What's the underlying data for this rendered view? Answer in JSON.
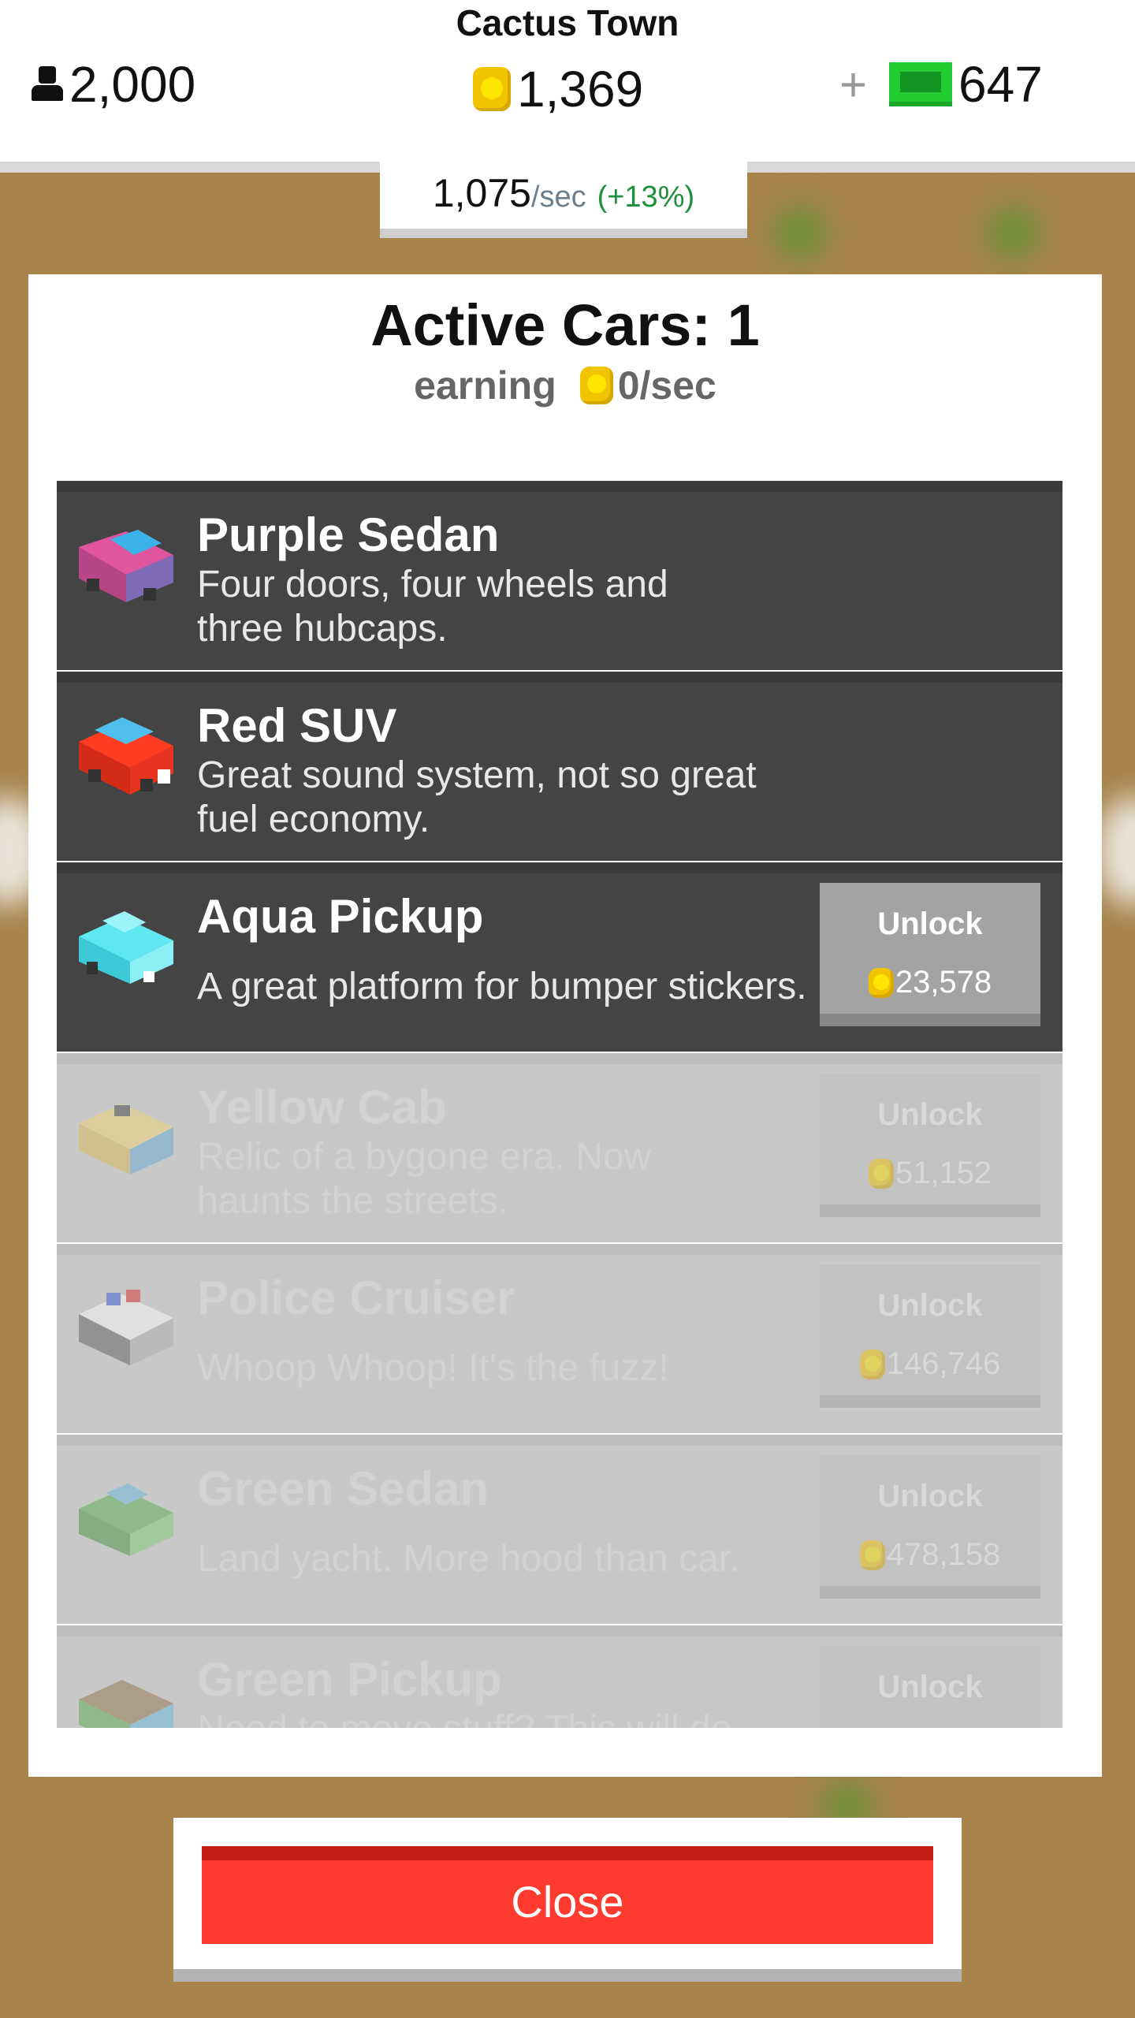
{
  "header": {
    "town_name": "Cactus Town",
    "population": "2,000",
    "coins": "1,369",
    "cash_plus": "+",
    "cash": "647",
    "rate_value": "1,075",
    "rate_unit": "/sec",
    "rate_pct": "(+13%)"
  },
  "modal": {
    "title": "Active Cars: 1",
    "earning_label": "earning",
    "earning_value": "0/sec",
    "cars": [
      {
        "name": "Purple Sedan",
        "desc": "Four doors, four wheels and three hubcaps.",
        "locked": false,
        "unlock": ""
      },
      {
        "name": "Red SUV",
        "desc": "Great sound system, not so great fuel economy.",
        "locked": false,
        "unlock": ""
      },
      {
        "name": "Aqua Pickup",
        "desc": "A great platform for bumper stickers.",
        "locked": false,
        "unlock": "Unlock",
        "cost": "23,578"
      },
      {
        "name": "Yellow Cab",
        "desc": "Relic of a bygone era. Now haunts the streets.",
        "locked": true,
        "unlock": "Unlock",
        "cost": "51,152"
      },
      {
        "name": "Police Cruiser",
        "desc": "Whoop Whoop! It's the fuzz!",
        "locked": true,
        "unlock": "Unlock",
        "cost": "146,746"
      },
      {
        "name": "Green Sedan",
        "desc": "Land yacht. More hood than car.",
        "locked": true,
        "unlock": "Unlock",
        "cost": "478,158"
      },
      {
        "name": "Green Pickup",
        "desc": "Need to move stuff? This will do the",
        "locked": true,
        "unlock": "Unlock",
        "cost": ""
      }
    ]
  },
  "close_label": "Close",
  "colors": {
    "accent_red": "#ff3b2f",
    "coin": "#f2c400",
    "cash": "#22cc33",
    "row_dark": "#444444",
    "row_locked": "#c8c8c8"
  }
}
